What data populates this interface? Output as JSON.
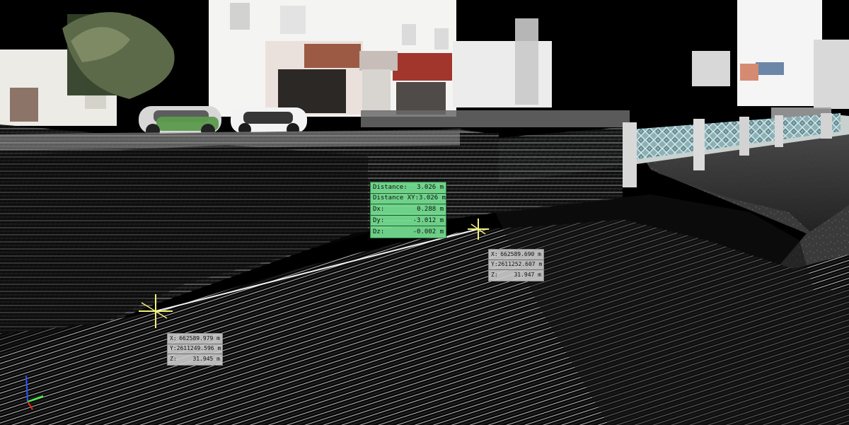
{
  "viewer": {
    "scene_type": "point-cloud-measurement",
    "colors": {
      "background": "#000000",
      "measurement_line": "#f2f2f2",
      "point_marker": "#f0f07a",
      "measurement_panel": "#7de59a",
      "coordinate_panel": "#d0d0d0"
    },
    "icons": {
      "point_a": "crosshair-point-icon",
      "point_b": "crosshair-point-icon",
      "axis": "axis-gizmo-icon"
    }
  },
  "measurement": {
    "distance_label": "Distance:",
    "distance_value": "3.026 m",
    "distance_xy_label": "Distance XY:",
    "distance_xy_value": "3.026 m",
    "dx_label": "Dx:",
    "dx_value": "0.288 m",
    "dy_label": "Dy:",
    "dy_value": "-3.012 m",
    "dz_label": "Dz:",
    "dz_value": "-0.002 m"
  },
  "point_a": {
    "x_label": "X:",
    "x_value": "662589.690 m",
    "y_label": "Y:",
    "y_value": "2611252.607 m",
    "z_label": "Z:",
    "z_value": "31.947 m"
  },
  "point_b": {
    "x_label": "X:",
    "x_value": "662589.979 m",
    "y_label": "Y:",
    "y_value": "2611249.596 m",
    "z_label": "Z:",
    "z_value": "31.945 m"
  }
}
